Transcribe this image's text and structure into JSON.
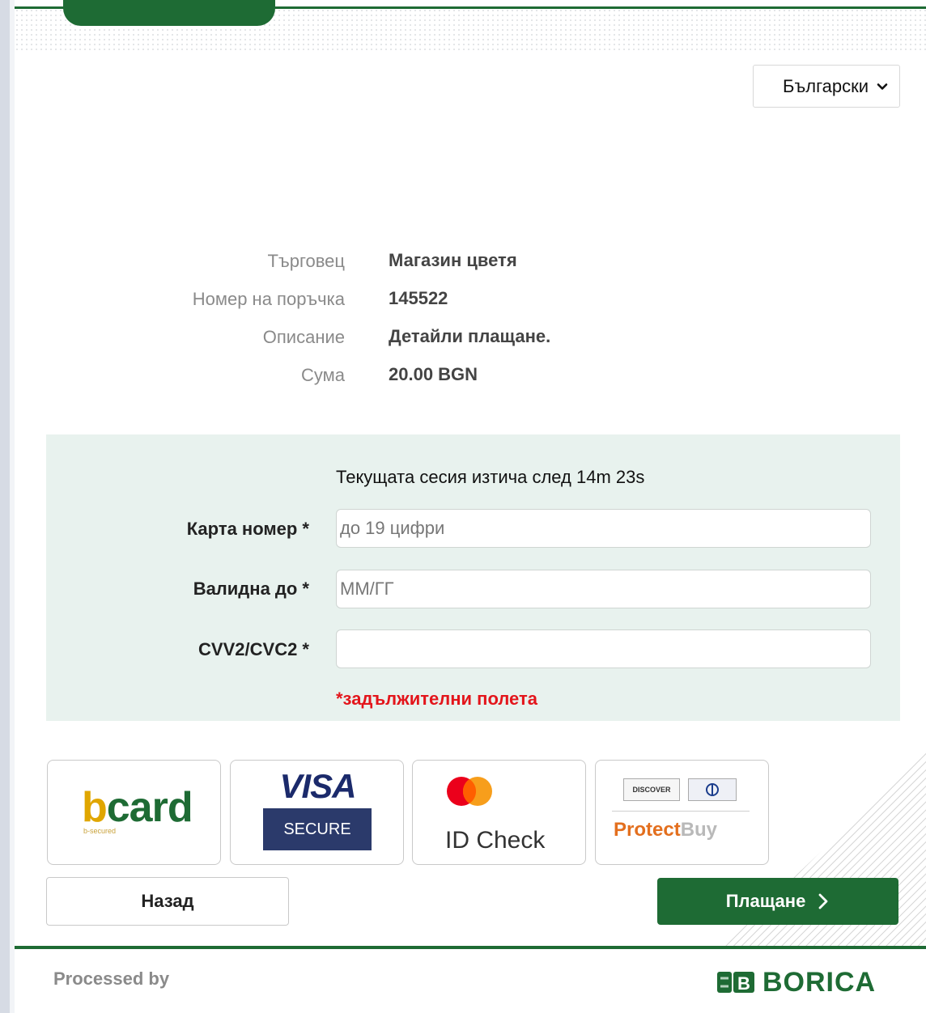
{
  "language": {
    "selected": "Български"
  },
  "order": {
    "merchant_label": "Търговец",
    "merchant_value": "Магазин цветя",
    "order_no_label": "Номер на поръчка",
    "order_no_value": "145522",
    "description_label": "Описание",
    "description_value": "Детайли плащане.",
    "amount_label": "Сума",
    "amount_value": "20.00 BGN"
  },
  "form": {
    "session_text": "Текущата сесия изтича след  14m 23s",
    "card_label": "Карта номер *",
    "card_placeholder": "до 19 цифри",
    "expiry_label": "Валидна до *",
    "expiry_placeholder": "ММ/ГГ",
    "cvv_label": "CVV2/CVC2 *",
    "cvv_placeholder": "",
    "required_note": "*задължителни полета"
  },
  "security_logos": {
    "bcard_b": "b",
    "bcard_card": "card",
    "bcard_sub": "b-secured",
    "visa_title": "VISA",
    "visa_sub": "SECURE",
    "mastercard_text": "ID Check",
    "discover_badge": "DISCOVER",
    "protectbuy_1": "Protect",
    "protectbuy_2": "Buy"
  },
  "actions": {
    "back_label": "Назад",
    "pay_label": "Плащане"
  },
  "footer": {
    "processed_by": "Processed by",
    "brand": "BORICA"
  },
  "colors": {
    "brand_green": "#1e6b34",
    "panel_bg": "#e8f2ee",
    "required_red": "#e3151b"
  }
}
